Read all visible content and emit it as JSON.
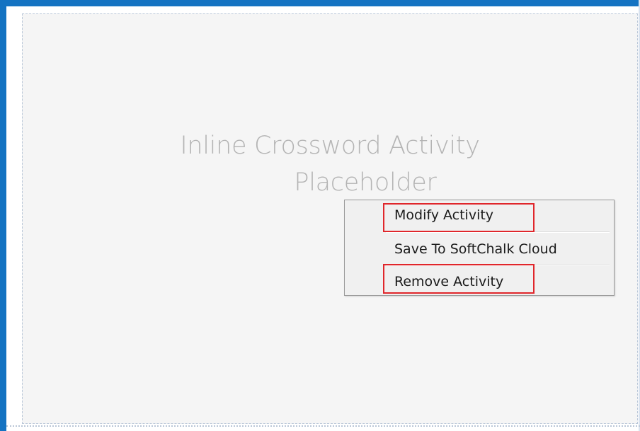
{
  "placeholder": {
    "line1": "Inline Crossword Activity",
    "line2": "Placeholder"
  },
  "context_menu": {
    "items": [
      {
        "label": "Modify Activity",
        "highlighted": true
      },
      {
        "label": "Save To SoftChalk Cloud",
        "highlighted": false
      },
      {
        "label": "Remove Activity",
        "highlighted": true
      }
    ]
  },
  "colors": {
    "frame": "#1473c2",
    "highlight": "#e0262b",
    "placeholder_background": "#f5f5f5",
    "menu_background": "#f0f0f0"
  }
}
